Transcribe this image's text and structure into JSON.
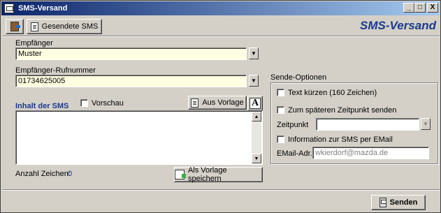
{
  "window": {
    "title": "SMS-Versand",
    "brand": "SMS-Versand"
  },
  "titlebar": {
    "minimize": "_",
    "maximize": "□",
    "close": "X"
  },
  "toolbar": {
    "sent_label": "Gesendete SMS"
  },
  "recipient": {
    "label": "Empfänger",
    "value": "Muster"
  },
  "recipient_number": {
    "label": "Empfänger-Rufnummer",
    "value": "01734625005"
  },
  "content": {
    "title": "Inhalt der SMS",
    "preview_label": "Vorschau",
    "template_button": "Aus Vorlage",
    "font_button": "A",
    "char_count_label": "Anzahl Zeichen:",
    "char_count_value": "0",
    "save_template_button": "Als Vorlage speichern"
  },
  "send_options": {
    "title": "Sende-Optionen",
    "shorten_label": "Text kürzen (160 Zeichen)",
    "later_label": "Zum späteren Zeitpunkt senden",
    "time_label": "Zeitpunkt",
    "time_value": "",
    "email_info_label": "Information zur SMS per EMail",
    "email_label": "EMail-Adr.",
    "email_value": "wkierdorf@mazda.de"
  },
  "footer": {
    "send_button": "Senden"
  },
  "colors": {
    "accent": "#1a3a8f",
    "field_yellow": "#ffffe1",
    "face": "#d4d0c8"
  }
}
